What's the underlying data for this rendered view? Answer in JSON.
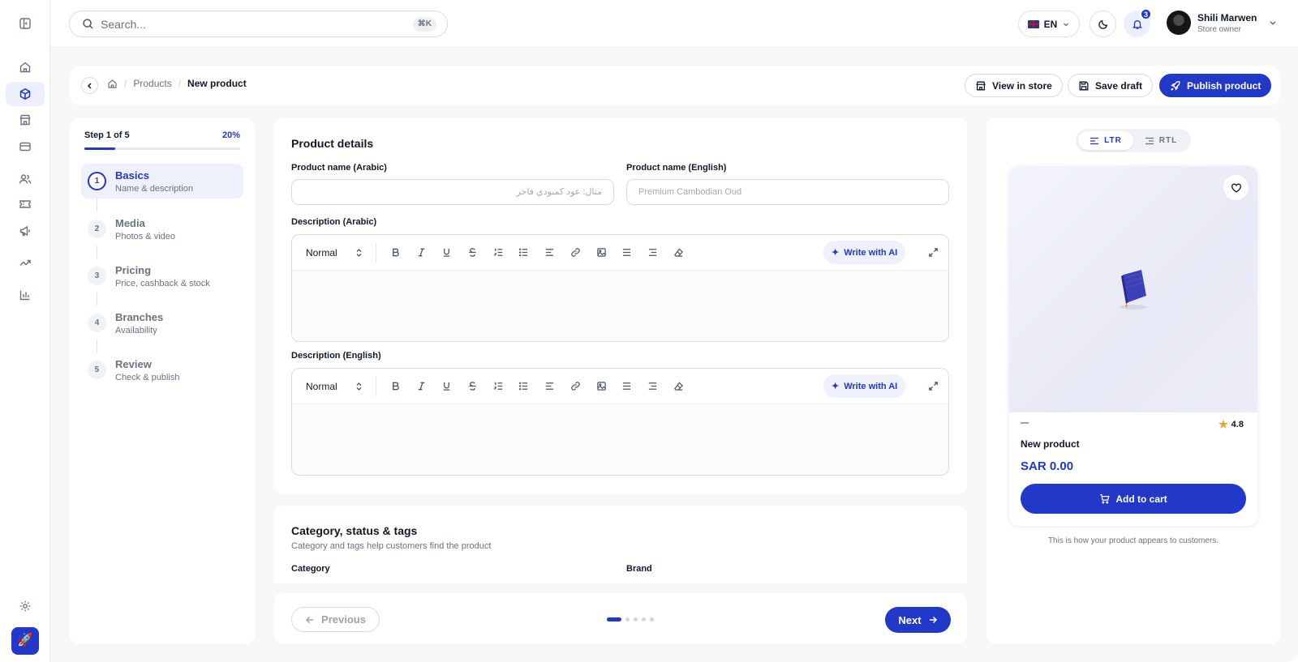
{
  "search": {
    "placeholder": "Search...",
    "shortcut": "⌘K"
  },
  "topbar": {
    "language": "EN",
    "notifications_count": "3",
    "user_name": "Shili Marwen",
    "user_role": "Store owner"
  },
  "breadcrumb": {
    "items": [
      "Products",
      "New product"
    ]
  },
  "actions": {
    "view_in_store": "View in store",
    "save_draft": "Save draft",
    "publish": "Publish product"
  },
  "steps": {
    "step_label": "Step 1 of 5",
    "percent": "20%",
    "progress": 0.2,
    "items": [
      {
        "num": "1",
        "title": "Basics",
        "sub": "Name & description"
      },
      {
        "num": "2",
        "title": "Media",
        "sub": "Photos & video"
      },
      {
        "num": "3",
        "title": "Pricing",
        "sub": "Price, cashback & stock"
      },
      {
        "num": "4",
        "title": "Branches",
        "sub": "Availability"
      },
      {
        "num": "5",
        "title": "Review",
        "sub": "Check & publish"
      }
    ]
  },
  "details": {
    "title": "Product details",
    "name_ar_label": "Product name (Arabic)",
    "name_ar_placeholder": "مثال: عود كمبودي فاخر",
    "name_en_label": "Product name (English)",
    "name_en_placeholder": "Premium Cambodian Oud",
    "desc_ar_label": "Description (Arabic)",
    "desc_en_label": "Description (English)",
    "editor_format": "Normal",
    "ai_label": "Write with AI"
  },
  "category_section": {
    "title": "Category, status & tags",
    "subtitle": "Category and tags help customers find the product",
    "category_label": "Category",
    "brand_label": "Brand"
  },
  "nav": {
    "previous": "Previous",
    "next": "Next"
  },
  "preview": {
    "ltr": "LTR",
    "rtl": "RTL",
    "rating": "4.8",
    "product_name": "New product",
    "price": "SAR 0.00",
    "add_to_cart": "Add to cart",
    "note": "This is how your product appears to customers."
  },
  "colors": {
    "accent": "#2138c8",
    "accent_soft": "#eef0fc",
    "star": "#f0a020"
  }
}
